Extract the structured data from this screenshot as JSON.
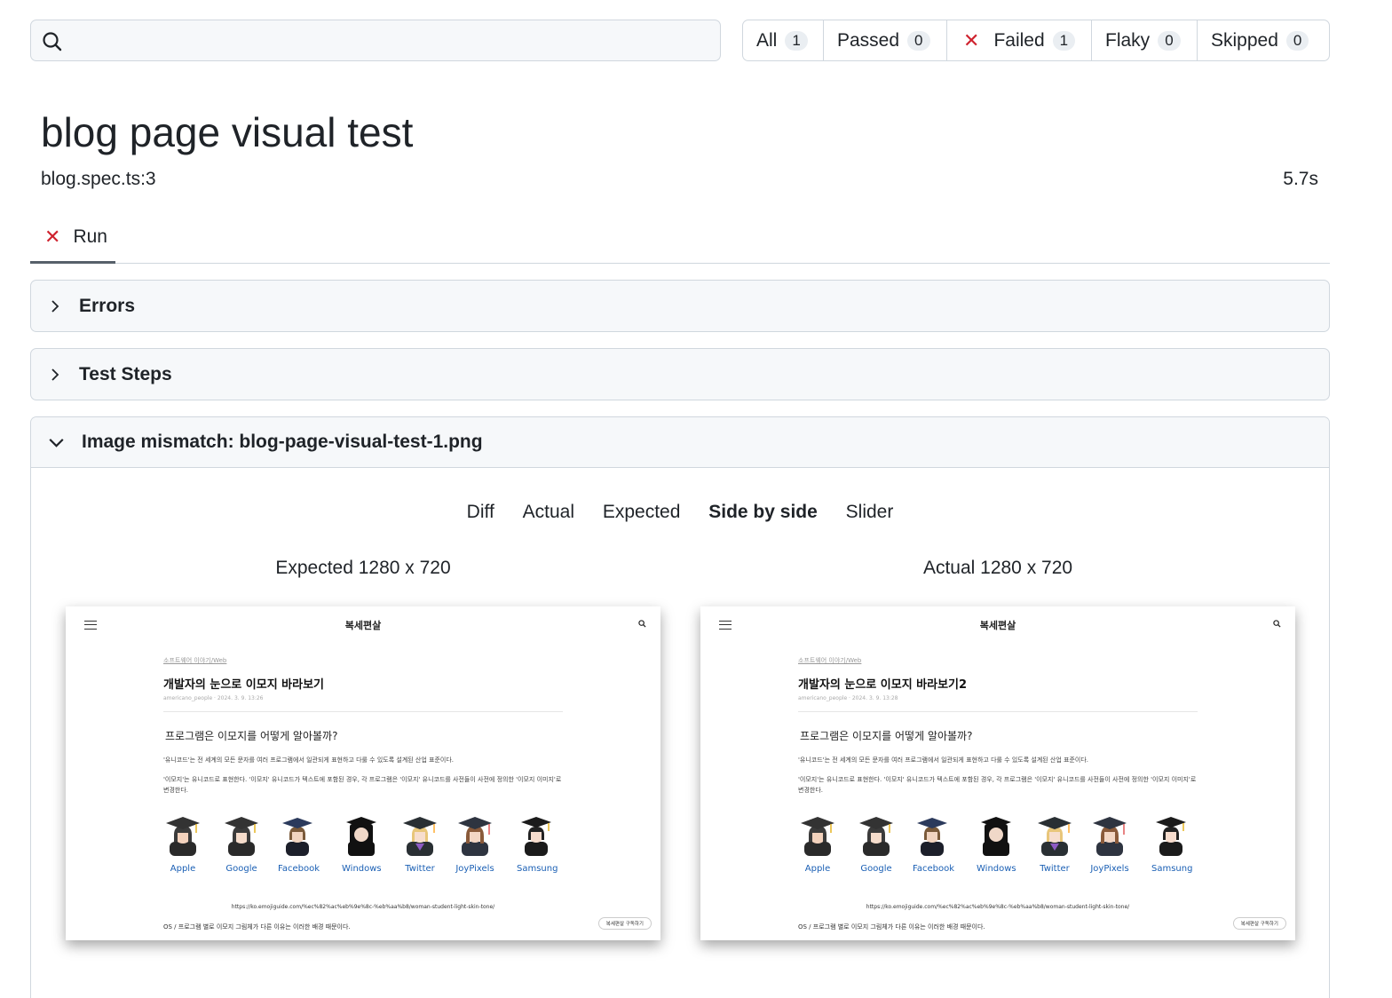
{
  "search": {
    "value": "",
    "placeholder": ""
  },
  "filters": [
    {
      "label": "All",
      "count": "1"
    },
    {
      "label": "Passed",
      "count": "0"
    },
    {
      "label": "Failed",
      "count": "1"
    },
    {
      "label": "Flaky",
      "count": "0"
    },
    {
      "label": "Skipped",
      "count": "0"
    }
  ],
  "test": {
    "title": "blog page visual test",
    "file": "blog.spec.ts:3",
    "duration": "5.7s"
  },
  "tabs": [
    {
      "label": "Run"
    }
  ],
  "sections": {
    "errors": "Errors",
    "steps": "Test Steps",
    "mismatch": "Image mismatch: blog-page-visual-test-1.png"
  },
  "views": [
    "Diff",
    "Actual",
    "Expected",
    "Side by side",
    "Slider"
  ],
  "active_view": "Side by side",
  "expected": {
    "caption": "Expected 1280 x 720",
    "brand": "복세편살",
    "crumb": "소프트웨어 이야기/Web",
    "title": "개발자의 눈으로 이모지 바라보기",
    "meta": "americano_people  ·  2024. 3. 9. 13:26",
    "heading": "프로그램은 이모지를 어떻게 알아볼까?",
    "p1": "'유니코드'는 전 세계의 모든 문자를 여러 프로그램에서 일관되게 표현하고 다룰 수 있도록 설계된 산업 표준이다.",
    "p2": "'이모지'는 유니코드로 표현한다. '이모지' 유니코드가 텍스트에 포함된 경우, 각 프로그램은 '이모지' 유니코드를 사전들이 사전에 정의한 '이모지 이미지'로 변경한다.",
    "vendors": [
      "Apple",
      "Google",
      "Facebook",
      "Windows",
      "Twitter",
      "JoyPixels",
      "Samsung"
    ],
    "url": "https://ko.emojiguide.com/%ec%82%ac%eb%9e%8c-%eb%aa%b8/woman-student-light-skin-tone/",
    "footer": "OS / 프로그램 별로 이모지 그림체가 다른 이유는 이러한 배경 때문이다.",
    "subscribe": "복세편살 구독하기"
  },
  "actual": {
    "caption": "Actual 1280 x 720",
    "brand": "복세편살",
    "crumb": "소프트웨어 이야기/Web",
    "title": "개발자의 눈으로 이모지 바라보기2",
    "meta": "americano_people  ·  2024. 3. 9. 13:28",
    "heading": "프로그램은 이모지를 어떻게 알아볼까?",
    "p1": "'유니코드'는 전 세계의 모든 문자를 여러 프로그램에서 일관되게 표현하고 다룰 수 있도록 설계된 산업 표준이다.",
    "p2": "'이모지'는 유니코드로 표현한다. '이모지' 유니코드가 텍스트에 포함된 경우, 각 프로그램은 '이모지' 유니코드를 사전들이 사전에 정의한 '이모지 이미지'로 변경한다.",
    "vendors": [
      "Apple",
      "Google",
      "Facebook",
      "Windows",
      "Twitter",
      "JoyPixels",
      "Samsung"
    ],
    "url": "https://ko.emojiguide.com/%ec%82%ac%eb%9e%8c-%eb%aa%b8/woman-student-light-skin-tone/",
    "footer": "OS / 프로그램 별로 이모지 그림체가 다른 이유는 이러한 배경 때문이다.",
    "subscribe": "복세편살 구독하기"
  },
  "colors": {
    "failed": "#cf222e",
    "link": "#1a5fb4",
    "border": "#d0d7de",
    "panel": "#f6f8fa"
  },
  "icons": [
    "search-icon",
    "close-icon",
    "chevron-right-icon",
    "chevron-down-icon",
    "menu-icon",
    "emoji-woman-student-icon"
  ]
}
